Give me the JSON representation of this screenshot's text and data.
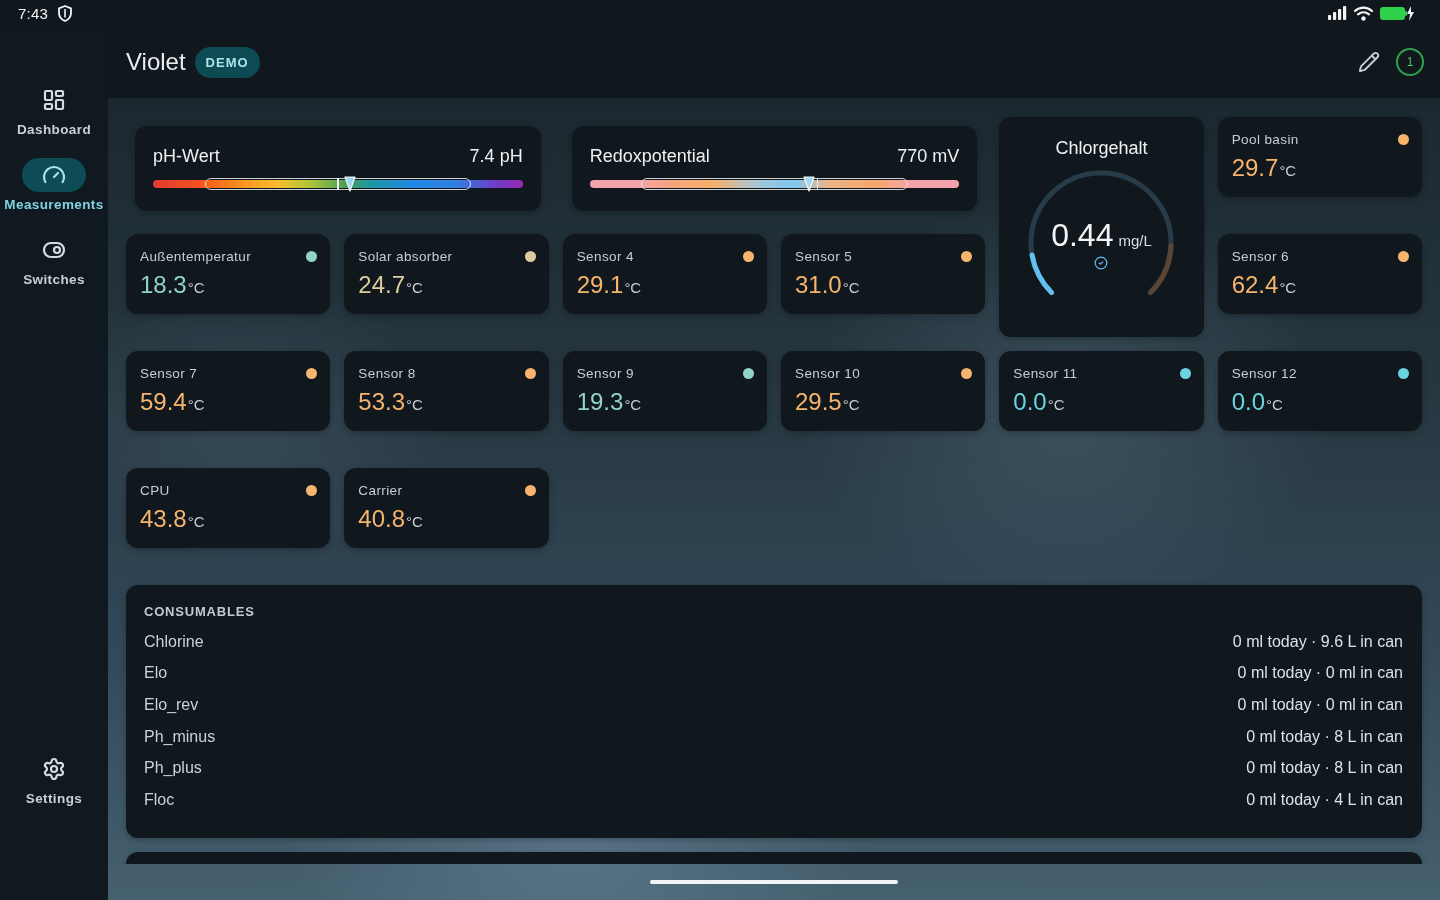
{
  "status_bar": {
    "time": "7:43"
  },
  "app_bar": {
    "title": "Violet",
    "badge": "DEMO",
    "counter": "1"
  },
  "sidebar": {
    "items": [
      {
        "kind": "dashboard",
        "label": "Dashboard",
        "selected": false
      },
      {
        "kind": "measurements",
        "label": "Measurements",
        "selected": true
      },
      {
        "kind": "switches",
        "label": "Switches",
        "selected": false
      }
    ],
    "footer_items": [
      {
        "kind": "settings",
        "label": "Settings",
        "selected": false
      }
    ]
  },
  "gauges": [
    {
      "kind": "ph",
      "title": "pH-Wert",
      "reading": "7.4 pH",
      "level": 0.534
    },
    {
      "kind": "redox",
      "title": "Redoxpotential",
      "reading": "770 mV",
      "level": 0.592
    }
  ],
  "chlorine": {
    "title": "Chlorgehalt",
    "value": "0.44",
    "unit": "mg/L",
    "level": 0.13,
    "in_range": true
  },
  "sensors": [
    {
      "name": "Pool basin",
      "value": "29.7",
      "unit": "°C",
      "color": "#f7b46c"
    },
    {
      "name": "Außentemperatur",
      "value": "18.3",
      "unit": "°C",
      "color": "#8fd4c9"
    },
    {
      "name": "Solar absorber",
      "value": "24.7",
      "unit": "°C",
      "color": "#dccca0"
    },
    {
      "name": "Sensor 4",
      "value": "29.1",
      "unit": "°C",
      "color": "#f7b46c"
    },
    {
      "name": "Sensor 5",
      "value": "31.0",
      "unit": "°C",
      "color": "#f7b46c"
    },
    {
      "name": "Sensor 6",
      "value": "62.4",
      "unit": "°C",
      "color": "#f7b46c"
    },
    {
      "name": "Sensor 7",
      "value": "59.4",
      "unit": "°C",
      "color": "#f7b46c"
    },
    {
      "name": "Sensor 8",
      "value": "53.3",
      "unit": "°C",
      "color": "#f7b46c"
    },
    {
      "name": "Sensor 9",
      "value": "19.3",
      "unit": "°C",
      "color": "#8fd4c9"
    },
    {
      "name": "Sensor 10",
      "value": "29.5",
      "unit": "°C",
      "color": "#f7b46c"
    },
    {
      "name": "Sensor 11",
      "value": "0.0",
      "unit": "°C",
      "color": "#6cd3e2"
    },
    {
      "name": "Sensor 12",
      "value": "0.0",
      "unit": "°C",
      "color": "#6cd3e2"
    },
    {
      "name": "CPU",
      "value": "43.8",
      "unit": "°C",
      "color": "#f7b46c"
    },
    {
      "name": "Carrier",
      "value": "40.8",
      "unit": "°C",
      "color": "#f7b46c"
    }
  ],
  "consumables": {
    "title": "CONSUMABLES",
    "rows": [
      {
        "name": "Chlorine",
        "detail": "0 ml today · 9.6 L in can"
      },
      {
        "name": "Elo",
        "detail": "0 ml today · 0 ml in can"
      },
      {
        "name": "Elo_rev",
        "detail": "0 ml today · 0 ml in can"
      },
      {
        "name": "Ph_minus",
        "detail": "0 ml today · 8 L in can"
      },
      {
        "name": "Ph_plus",
        "detail": "0 ml today · 8 L in can"
      },
      {
        "name": "Floc",
        "detail": "0 ml today · 4 L in can"
      }
    ]
  }
}
